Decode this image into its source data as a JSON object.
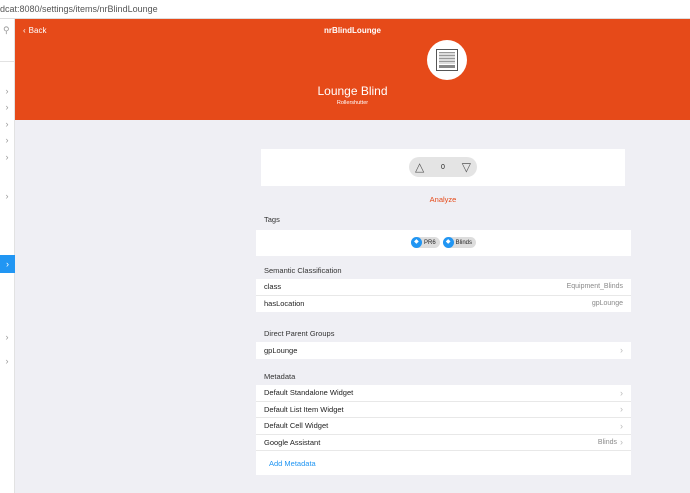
{
  "browser": {
    "url": "dcat:8080/settings/items/nrBlindLounge"
  },
  "nav": {
    "back_label": "Back",
    "title": "nrBlindLounge"
  },
  "item": {
    "label": "Lounge Blind",
    "type": "Rollershutter",
    "icon": "blinds-icon"
  },
  "control": {
    "up_icon": "△",
    "value": "0",
    "down_icon": "▽"
  },
  "analyze_label": "Analyze",
  "tags": {
    "title": "Tags",
    "items": [
      "PR6",
      "Blinds"
    ]
  },
  "semantic": {
    "title": "Semantic Classification",
    "rows": [
      {
        "label": "class",
        "value": "Equipment_Blinds"
      },
      {
        "label": "hasLocation",
        "value": "gpLounge"
      }
    ]
  },
  "parents": {
    "title": "Direct Parent Groups",
    "rows": [
      {
        "label": "gpLounge"
      }
    ]
  },
  "metadata": {
    "title": "Metadata",
    "rows": [
      {
        "label": "Default Standalone Widget",
        "value": ""
      },
      {
        "label": "Default List Item Widget",
        "value": ""
      },
      {
        "label": "Default Cell Widget",
        "value": ""
      },
      {
        "label": "Google Assistant",
        "value": "Blinds"
      }
    ],
    "add_label": "Add Metadata"
  },
  "colors": {
    "header": "#e64a19",
    "accent": "#2196f3"
  }
}
